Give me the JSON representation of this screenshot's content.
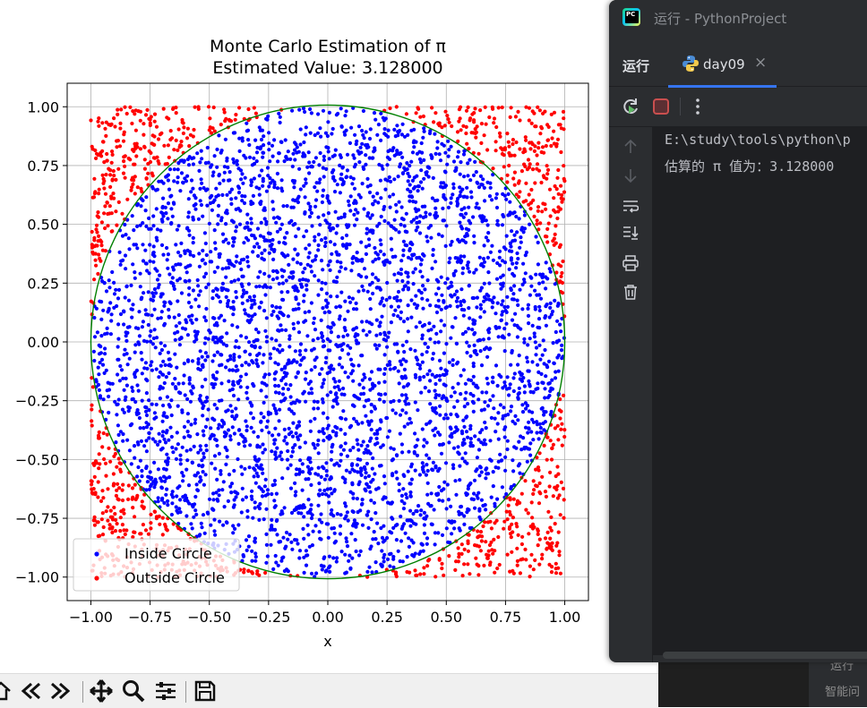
{
  "figure": {
    "chart_data": {
      "type": "scatter",
      "title": "Monte Carlo Estimation of π",
      "subtitle": "Estimated Value: 3.128000",
      "xlabel": "x",
      "ylabel": "",
      "xlim": [
        -1.1,
        1.1
      ],
      "ylim": [
        -1.1,
        1.1
      ],
      "x_ticks": [
        "−1.00",
        "−0.75",
        "−0.50",
        "−0.25",
        "0.00",
        "0.25",
        "0.50",
        "0.75",
        "1.00"
      ],
      "y_ticks": [
        "1.00",
        "0.75",
        "0.50",
        "0.25",
        "0.00",
        "−0.25",
        "−0.50",
        "−0.75",
        "−1.00"
      ],
      "tick_values": [
        -1.0,
        -0.75,
        -0.5,
        -0.25,
        0.0,
        0.25,
        0.5,
        0.75,
        1.0
      ],
      "grid": true,
      "circle": {
        "center": [
          0,
          0
        ],
        "radius": 1.0,
        "color": "#008000"
      },
      "series": [
        {
          "name": "Inside Circle",
          "color": "#0000ff",
          "points": "uniform random points with x²+y² ≤ 1"
        },
        {
          "name": "Outside Circle",
          "color": "#ff0000",
          "points": "uniform random points with x²+y² > 1"
        }
      ],
      "legend_placement": "lower-left"
    }
  },
  "mpl_toolbar": {
    "icons": [
      "home-icon",
      "back-icon",
      "forward-icon",
      "pan-icon",
      "zoom-icon",
      "configure-subplots-icon",
      "save-icon"
    ]
  },
  "ide": {
    "window_title": "运行 - PythonProject",
    "tool_window_label": "运行",
    "run_tab": {
      "label": "day09",
      "close_glyph": "×"
    },
    "console_lines": [
      "E:\\study\\tools\\python\\p",
      "估算的 π 值为：3.128000"
    ],
    "colors": {
      "accent": "#3574f0",
      "stop": "#c94f4f",
      "rerun": "#5fb865"
    }
  },
  "behind_window": {
    "fragment_1": "运行",
    "fragment_2": "智能问"
  }
}
